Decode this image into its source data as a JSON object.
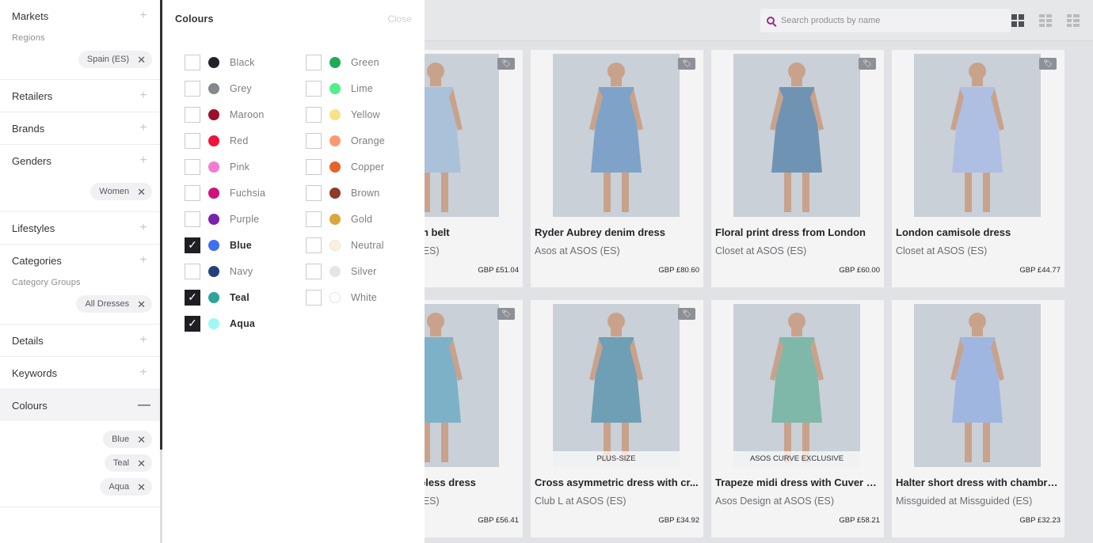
{
  "sidebar": {
    "sections": [
      {
        "label": "Markets",
        "sub": "Regions",
        "chips": [
          "Spain (ES)"
        ],
        "active": false
      },
      {
        "label": "Retailers",
        "active": false
      },
      {
        "label": "Brands",
        "active": false
      },
      {
        "label": "Genders",
        "chips": [
          "Women"
        ],
        "active": false
      },
      {
        "label": "Lifestyles",
        "active": false
      },
      {
        "label": "Categories",
        "sub": "Category Groups",
        "chips": [
          "All Dresses"
        ],
        "active": false
      },
      {
        "label": "Details",
        "active": false
      },
      {
        "label": "Keywords",
        "active": false
      },
      {
        "label": "Colours",
        "chips": [
          "Blue",
          "Teal",
          "Aqua"
        ],
        "active": true
      }
    ]
  },
  "panel": {
    "title": "Colours",
    "close_label": "Close",
    "columns": [
      [
        {
          "label": "Black",
          "color": "#22232a",
          "checked": false
        },
        {
          "label": "Grey",
          "color": "#84878c",
          "checked": false
        },
        {
          "label": "Maroon",
          "color": "#9a0f2a",
          "checked": false
        },
        {
          "label": "Red",
          "color": "#f0143c",
          "checked": false
        },
        {
          "label": "Pink",
          "color": "#f57ad0",
          "checked": false
        },
        {
          "label": "Fuchsia",
          "color": "#d0127c",
          "checked": false
        },
        {
          "label": "Purple",
          "color": "#7a22ad",
          "checked": false
        },
        {
          "label": "Blue",
          "color": "#3e6ff0",
          "checked": true
        },
        {
          "label": "Navy",
          "color": "#22427a",
          "checked": false
        },
        {
          "label": "Teal",
          "color": "#2aa59a",
          "checked": true
        },
        {
          "label": "Aqua",
          "color": "#9ef8f6",
          "checked": true
        }
      ],
      [
        {
          "label": "Green",
          "color": "#1eaa5a",
          "checked": false
        },
        {
          "label": "Lime",
          "color": "#4ff08a",
          "checked": false
        },
        {
          "label": "Yellow",
          "color": "#f7e18a",
          "checked": false
        },
        {
          "label": "Orange",
          "color": "#f99a6e",
          "checked": false
        },
        {
          "label": "Copper",
          "color": "#e5632a",
          "checked": false
        },
        {
          "label": "Brown",
          "color": "#8f3a2a",
          "checked": false
        },
        {
          "label": "Gold",
          "color": "#dba63a",
          "checked": false
        },
        {
          "label": "Neutral",
          "color": "#fdf0da",
          "checked": false
        },
        {
          "label": "Silver",
          "color": "#e3e5ea",
          "checked": false
        },
        {
          "label": "White",
          "color": "#ffffff",
          "checked": false
        }
      ]
    ]
  },
  "search": {
    "placeholder": "Search products by name"
  },
  "products": [
    {
      "title": "Midi dress with belt",
      "sub": "Asos at ASOS (ES)",
      "price": "GBP £51.04",
      "tag": true,
      "banner": "",
      "dress": "#a9c2d9"
    },
    {
      "title": "Ryder Aubrey denim dress",
      "sub": "Asos at ASOS (ES)",
      "price": "GBP £80.60",
      "tag": true,
      "banner": "",
      "dress": "#7fa3c8"
    },
    {
      "title": "Floral print dress from London",
      "sub": "Closet at ASOS (ES)",
      "price": "GBP £60.00",
      "tag": true,
      "banner": "",
      "dress": "#6f94b3"
    },
    {
      "title": "London camisole dress",
      "sub": "Closet at ASOS (ES)",
      "price": "GBP £44.77",
      "tag": true,
      "banner": "",
      "dress": "#aebfe3"
    },
    {
      "title": "Bandeau strapless dress",
      "sub": "Asos at ASOS (ES)",
      "price": "GBP £56.41",
      "tag": true,
      "banner": "",
      "dress": "#7db1c8"
    },
    {
      "title": "Cross asymmetric dress with cr...",
      "sub": "Club L at ASOS (ES)",
      "price": "GBP £34.92",
      "tag": true,
      "banner": "PLUS-SIZE",
      "dress": "#6f9fb5"
    },
    {
      "title": "Trapeze midi dress with Cuver e...",
      "sub": "Asos Design at ASOS (ES)",
      "price": "GBP £58.21",
      "tag": false,
      "banner": "ASOS CURVE EXCLUSIVE",
      "dress": "#7fb8a8"
    },
    {
      "title": "Halter short dress with chambra...",
      "sub": "Missguided at Missguided (ES)",
      "price": "GBP £32.23",
      "tag": false,
      "banner": "",
      "dress": "#9fb6e0"
    }
  ]
}
